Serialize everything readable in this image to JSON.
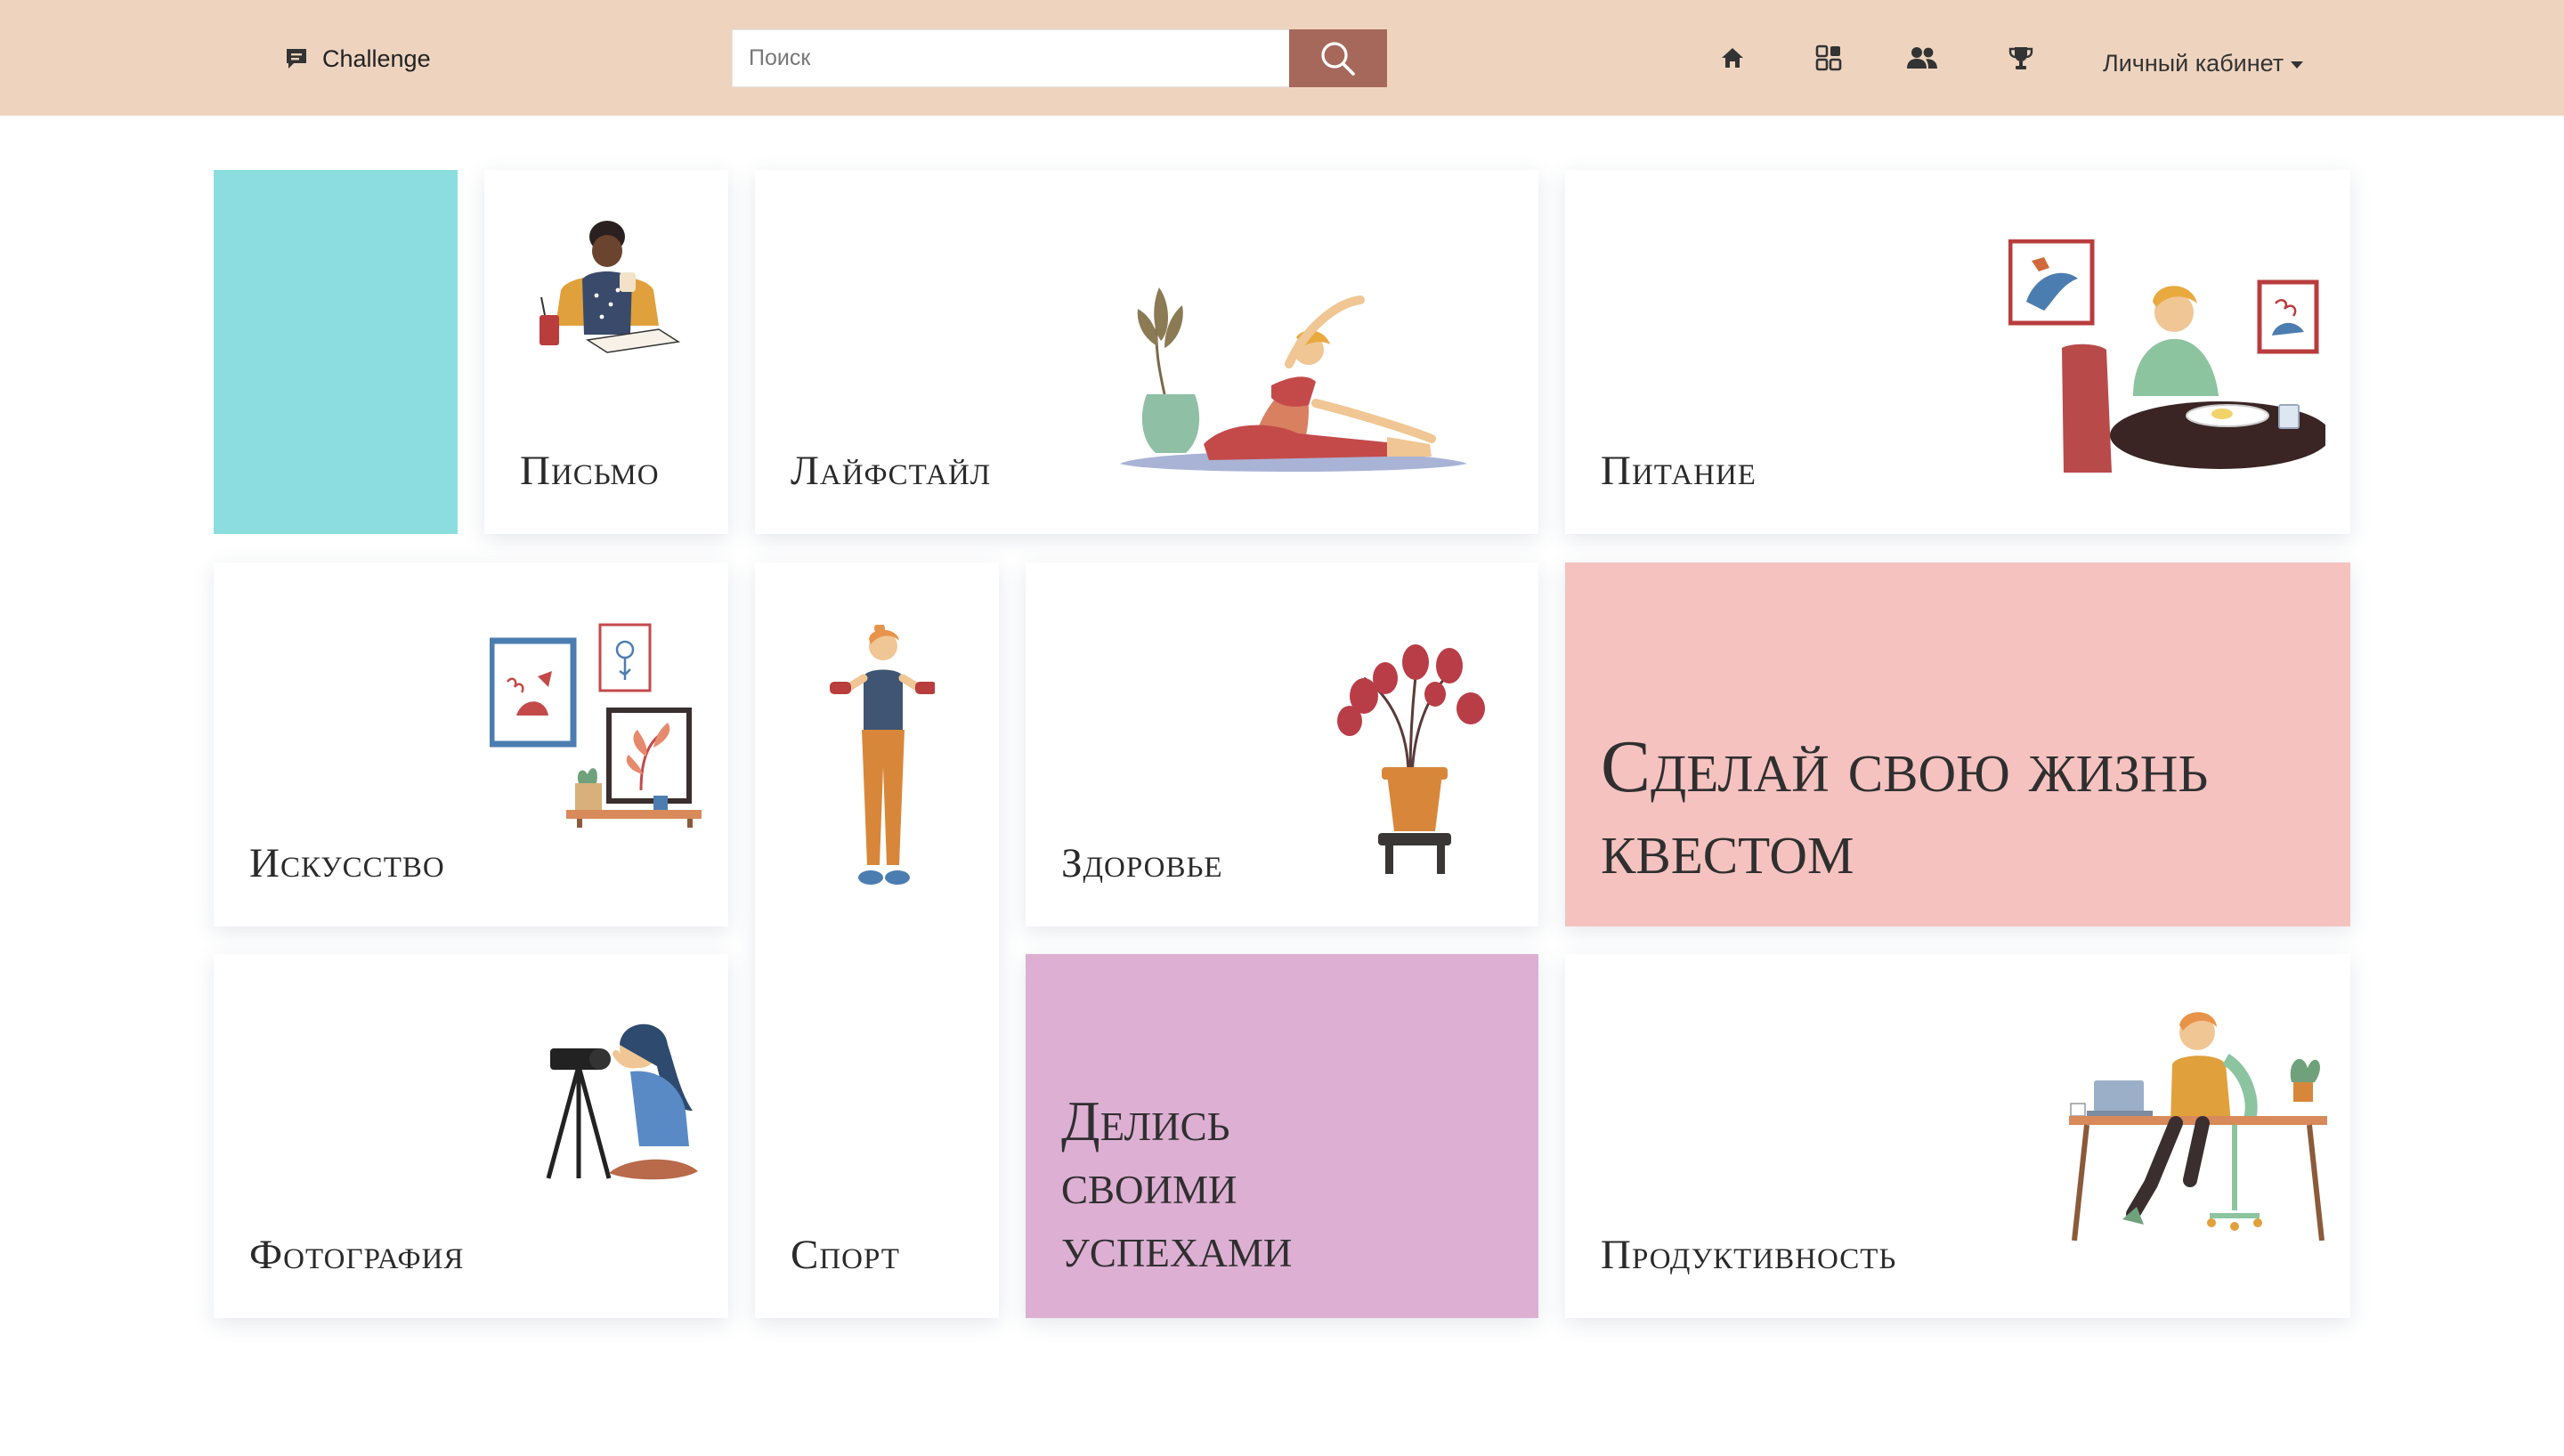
{
  "navbar": {
    "brand": "Challenge",
    "search_placeholder": "Поиск",
    "account_label": "Личный кабинет",
    "icons": [
      "home-icon",
      "grid-icon",
      "users-icon",
      "trophy-icon"
    ]
  },
  "tiles": {
    "writing": "Письмо",
    "lifestyle": "Лайфстайл",
    "nutrition": "Питание",
    "art": "Искусство",
    "sport": "Спорт",
    "health": "Здоровье",
    "photography": "Фотография",
    "productivity": "Продуктивность"
  },
  "promos": {
    "quest": "Сделай свою жизнь квестом",
    "share_line1": "Делись",
    "share_line2": "своими",
    "share_line3": "успехами"
  },
  "colors": {
    "navbar_bg": "#EED4BF",
    "search_button": "#A5685A",
    "teal_tile": "#8BDDE0",
    "pink_tile": "#F5C2C0",
    "lilac_tile": "#DDAFD3"
  }
}
